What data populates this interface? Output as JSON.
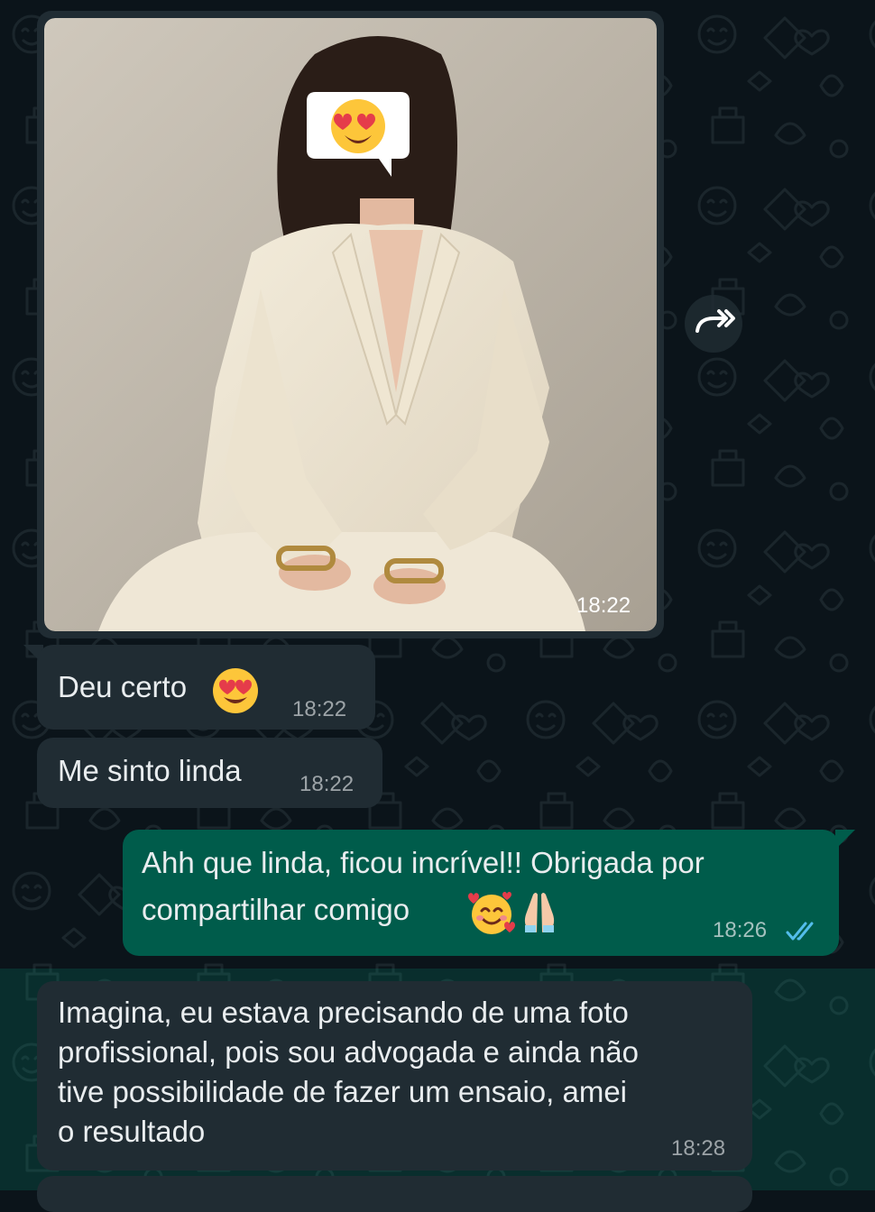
{
  "messages": [
    {
      "id": "image",
      "direction": "incoming",
      "type": "image",
      "time": "18:22",
      "image_description": "woman in cream blazer, face covered with heart-eyes emoji"
    },
    {
      "id": "msg1",
      "direction": "incoming",
      "text": "Deu certo",
      "emoji": "heart-eyes",
      "time": "18:22"
    },
    {
      "id": "msg2",
      "direction": "incoming",
      "text": "Me sinto linda",
      "time": "18:22"
    },
    {
      "id": "msg3",
      "direction": "outgoing",
      "lines": [
        "Ahh que linda, ficou incrível!! Obrigada por",
        "compartilhar comigo"
      ],
      "emojis": [
        "smiling-face-with-hearts",
        "folded-hands"
      ],
      "time": "18:26",
      "status": "read"
    },
    {
      "id": "msg4",
      "direction": "incoming",
      "lines": [
        "Imagina, eu estava precisando de uma foto",
        "profissional, pois sou advogada e ainda não",
        "tive possibilidade de fazer um ensaio, amei",
        "o resultado"
      ],
      "time": "18:28"
    }
  ],
  "colors": {
    "chat_bg": "#0b141a",
    "incoming_bubble": "#202c33",
    "outgoing_bubble": "#005c4b",
    "text": "#e9edef",
    "read_ticks": "#53bdeb"
  },
  "icons": {
    "forward": "forward-icon",
    "read_receipt": "double-check-icon"
  }
}
